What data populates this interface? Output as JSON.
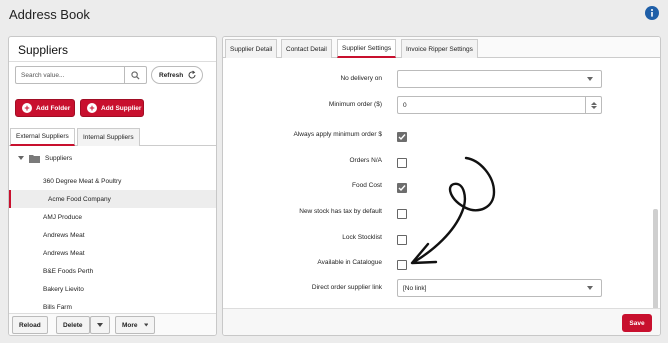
{
  "app": {
    "title": "Address Book"
  },
  "suppliers_panel": {
    "title": "Suppliers",
    "search": {
      "placeholder": "Search value...",
      "value": ""
    },
    "refresh_label": "Refresh",
    "add_folder_label": "Add Folder",
    "add_supplier_label": "Add Supplier",
    "tabs": [
      {
        "label": "External Suppliers",
        "active": true
      },
      {
        "label": "Internal Suppliers",
        "active": false
      }
    ],
    "tree_root": "Suppliers",
    "items": [
      "360 Degree Meat & Poultry",
      "Acme Food Company",
      "AMJ Produce",
      "Andrews Meat",
      "Andrews Meat",
      "B&E Foods Perth",
      "Bakery Lievito",
      "Bills Farm"
    ],
    "selected_index": 1,
    "footer": {
      "reload_label": "Reload",
      "delete_label": "Delete",
      "more_label": "More"
    }
  },
  "detail_panel": {
    "tabs": [
      {
        "label": "Supplier Detail",
        "active": false
      },
      {
        "label": "Contact Detail",
        "active": false
      },
      {
        "label": "Supplier Settings",
        "active": true
      },
      {
        "label": "Invoice Ripper Settings",
        "active": false
      }
    ],
    "fields": {
      "no_delivery_on": {
        "label": "No delivery on",
        "value": ""
      },
      "minimum_order": {
        "label": "Minimum order ($)",
        "value": "0"
      },
      "always_apply_minimum": {
        "label": "Always apply minimum order $",
        "checked": true
      },
      "orders_na": {
        "label": "Orders N/A",
        "checked": false
      },
      "food_cost": {
        "label": "Food Cost",
        "checked": true
      },
      "new_stock_tax": {
        "label": "New stock has tax by default",
        "checked": false
      },
      "lock_stocklist": {
        "label": "Lock Stocklist",
        "checked": false
      },
      "available_in_catalogue": {
        "label": "Available in Catalogue",
        "checked": false
      },
      "direct_order_link": {
        "label": "Direct order supplier link",
        "value": "[No link]"
      }
    },
    "save_label": "Save"
  },
  "colors": {
    "accent": "#c8102e",
    "checkbox_checked": "#6d6d6d",
    "info": "#1f5fa8"
  },
  "icons": [
    "info-icon",
    "search-icon",
    "refresh-icon",
    "plus-icon",
    "folder-icon",
    "caret-down-icon",
    "chevron-down-icon",
    "spin-arrows-icon",
    "check-icon",
    "annotation-arrow"
  ]
}
